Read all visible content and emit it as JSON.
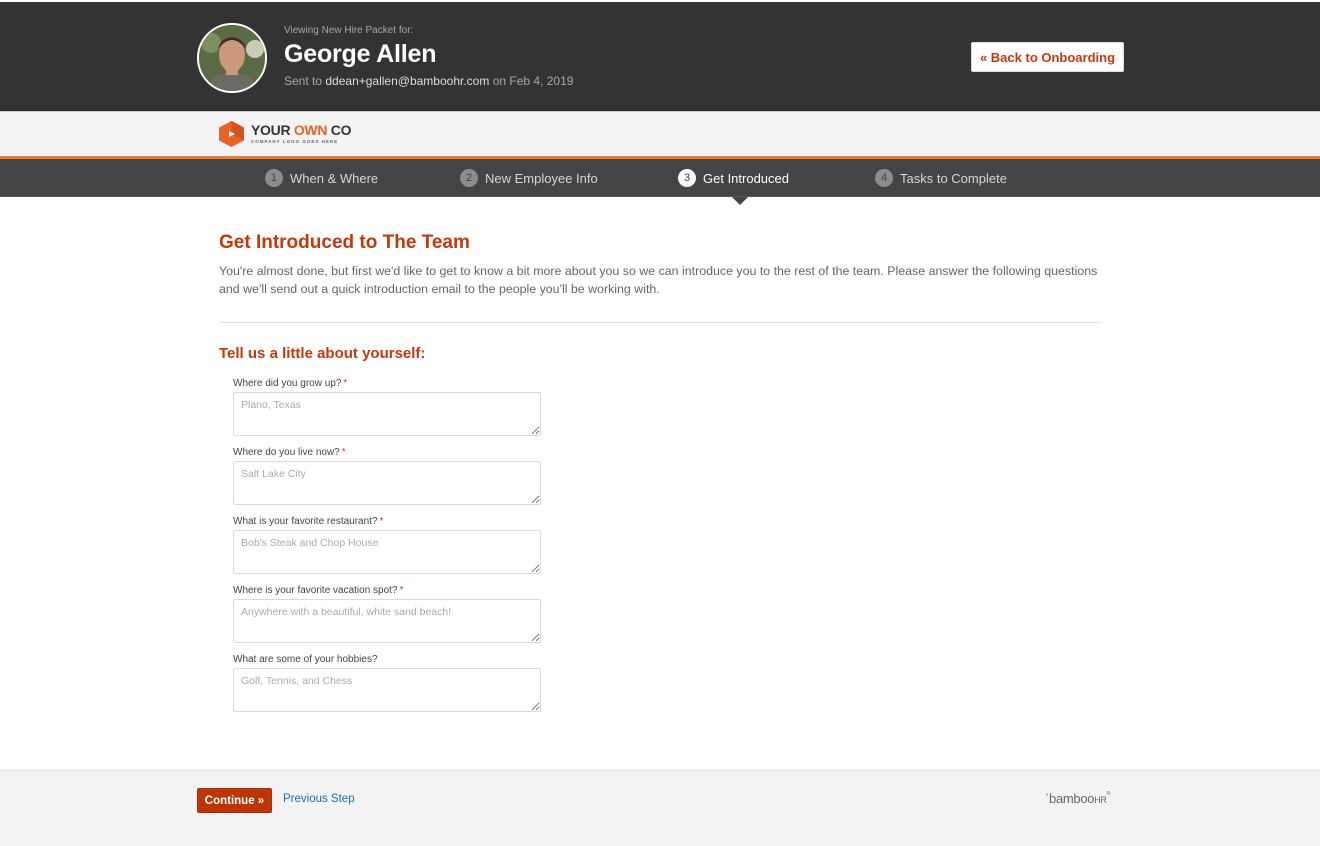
{
  "header": {
    "viewing_label": "Viewing New Hire Packet for:",
    "employee_name": "George Allen",
    "sent_prefix": "Sent to",
    "sent_email": "ddean+gallen@bamboohr.com",
    "sent_suffix": "on Feb 4, 2019",
    "back_button": "« Back to Onboarding",
    "avatar_icon": "employee-photo"
  },
  "logo": {
    "word1": "YOUR",
    "word2": "OWN",
    "word3": "CO",
    "tagline": "COMPANY LOGO GOES HERE",
    "icon": "hexagon-play-icon",
    "brand_color": "#e8622a"
  },
  "steps": [
    {
      "num": "1",
      "label": "When & Where",
      "active": false
    },
    {
      "num": "2",
      "label": "New Employee Info",
      "active": false
    },
    {
      "num": "3",
      "label": "Get Introduced",
      "active": true
    },
    {
      "num": "4",
      "label": "Tasks to Complete",
      "active": false
    }
  ],
  "main": {
    "title": "Get Introduced to The Team",
    "intro": "You're almost done, but first we'd like to get to know a bit more about you so we can introduce you to the rest of the team. Please answer the following questions and we'll send out a quick introduction email to the people you'll be working with.",
    "section_title": "Tell us a little about yourself:",
    "fields": [
      {
        "label": "Where did you grow up?",
        "required": "*",
        "value": "",
        "placeholder": "Plano, Texas"
      },
      {
        "label": "Where do you live now?",
        "required": "*",
        "value": "",
        "placeholder": "Salt Lake City"
      },
      {
        "label": "What is your favorite restaurant?",
        "required": "*",
        "value": "",
        "placeholder": "Bob's Steak and Chop House"
      },
      {
        "label": "Where is your favorite vacation spot?",
        "required": "*",
        "value": "",
        "placeholder": "Anywhere with a beautiful, white sand beach!"
      },
      {
        "label": "What are some of your hobbies?",
        "required": "",
        "value": "",
        "placeholder": "Golf, Tennis, and Chess"
      }
    ]
  },
  "footer": {
    "continue_button": "Continue »",
    "previous_link": "Previous Step",
    "brand_main": "bamboo",
    "brand_hr": "HR",
    "brand_reg": "®"
  },
  "colors": {
    "accent": "#c23a0b",
    "header_bg": "#333333",
    "nav_bg": "#444444",
    "orange_rule": "#f07a30",
    "link": "#1a6db3"
  }
}
